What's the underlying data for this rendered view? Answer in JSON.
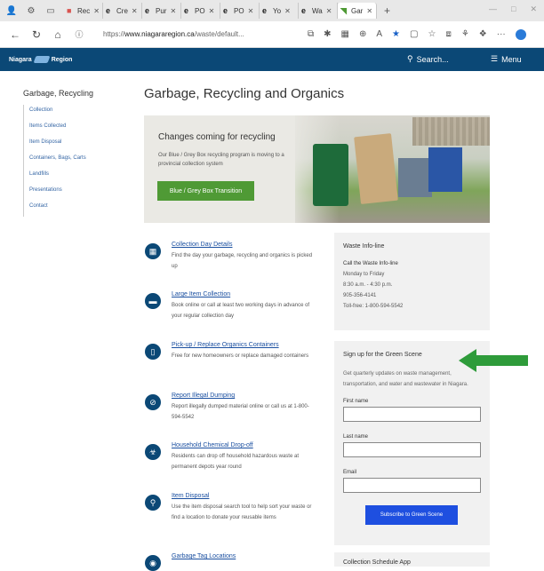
{
  "browser": {
    "tabs": [
      {
        "icon": "person-icon",
        "label": ""
      },
      {
        "icon": "settings-icon",
        "label": ""
      },
      {
        "icon": "sidebar-icon",
        "label": ""
      },
      {
        "icon": "app-icon",
        "label": "Rec"
      },
      {
        "icon": "edge-icon",
        "label": "Cre"
      },
      {
        "icon": "edge-icon",
        "label": "Pur"
      },
      {
        "icon": "edge-icon",
        "label": "PO"
      },
      {
        "icon": "edge-icon",
        "label": "PO"
      },
      {
        "icon": "edge-icon",
        "label": "Yo"
      },
      {
        "icon": "edge-icon",
        "label": "Wa"
      },
      {
        "icon": "niagara-icon",
        "label": "Gar",
        "active": true
      }
    ],
    "url_prefix": "https://",
    "url_domain": "www.niagararegion.ca",
    "url_path": "/waste/default...",
    "window_controls": [
      "—",
      "□",
      "✕"
    ]
  },
  "header": {
    "logo_text_left": "Niagara",
    "logo_text_right": "Region",
    "search_label": "Search...",
    "menu_label": "Menu",
    "bg_color": "#0b4876"
  },
  "leftnav": {
    "heading": "Garbage, Recycling",
    "items": [
      "Collection",
      "Items Collected",
      "Item Disposal",
      "Containers, Bags, Carts",
      "Landfills",
      "Presentations",
      "Contact"
    ]
  },
  "page_title": "Garbage, Recycling and Organics",
  "hero": {
    "title": "Changes coming for recycling",
    "text": "Our Blue / Grey Box recycling program is moving to a provincial collection system",
    "button": "Blue / Grey Box Transition",
    "button_color": "#4f9a35"
  },
  "services": [
    {
      "icon": "calendar-icon",
      "glyph": "▦",
      "title": "Collection Day Details",
      "desc": "Find the day your garbage, recycling and organics is picked up"
    },
    {
      "icon": "couch-icon",
      "glyph": "▬",
      "title": "Large Item Collection",
      "desc": "Book online or call at least two working days in advance of your regular collection day"
    },
    {
      "icon": "bin-icon",
      "glyph": "▯",
      "title": "Pick-up / Replace Organics Containers",
      "desc": "Free for new homeowners or replace damaged containers"
    },
    {
      "icon": "no-dumping-icon",
      "glyph": "⊘",
      "title": "Report Illegal Dumping",
      "desc": "Report illegally dumped material online or call us at 1-800-594-5542"
    },
    {
      "icon": "hazard-icon",
      "glyph": "☣",
      "title": "Household Chemical Drop-off",
      "desc": "Residents can drop off household hazardous waste at permanent depots year round"
    },
    {
      "icon": "location-icon",
      "glyph": "⚲",
      "title": "Item Disposal",
      "desc": "Use the item disposal search tool to help sort your waste or find a location to donate your reusable items"
    },
    {
      "icon": "pin-icon",
      "glyph": "◉",
      "title": "Garbage Tag Locations",
      "desc": ""
    }
  ],
  "waste_info": {
    "title": "Waste Info-line",
    "call_label": "Call the Waste Info-line",
    "days": "Monday to Friday",
    "hours": "8:30 a.m. - 4:30 p.m.",
    "phone": "905-356-4141",
    "tollfree": "Toll-free: 1-800-594-5542"
  },
  "signup": {
    "title": "Sign up for the Green Scene",
    "desc": "Get quarterly updates on waste management, transportation, and water and wastewater in Niagara.",
    "first_name_label": "First name",
    "last_name_label": "Last name",
    "email_label": "Email",
    "button": "Subscribe to Green Scene",
    "button_color": "#1e4fe0"
  },
  "schedule_title": "Collection Schedule App",
  "annotation_arrow_color": "#2e9b3a"
}
